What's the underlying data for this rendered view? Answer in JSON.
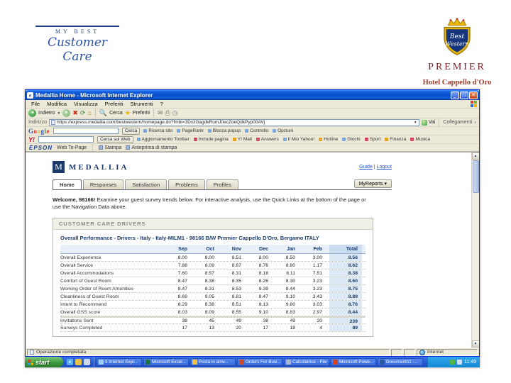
{
  "colors": {
    "medallia_navy": "#1b3a6b",
    "xp_titlebar_blue": "#0a50cf",
    "taskbar_blue": "#2458d4",
    "start_green": "#3c9a3c",
    "best_western_gold": "#e8b50c",
    "premier_maroon": "#7b1e24",
    "total_column_blue": "#dce9f5"
  },
  "slide": {
    "logo_left": {
      "line1": "MY BEST",
      "line2": "Customer Care"
    },
    "logo_right": {
      "shield_line1": "Best",
      "shield_line2": "Western",
      "premier": "PREMIER",
      "hotel": "Hotel Cappello d'Oro"
    }
  },
  "browser": {
    "title": "Medallia Home - Microsoft Internet Explorer",
    "menu": [
      "File",
      "Modifica",
      "Visualizza",
      "Preferiti",
      "Strumenti",
      "?"
    ],
    "toolbar": {
      "back": "Indietro",
      "search": "Cerca",
      "favorites": "Preferiti"
    },
    "address": {
      "label": "Indirizzo",
      "url": "https://express.medallia.com/bestwestern/homepage.do?fmbi=3DxzGagdkRumJ0ecZoeQdkPyp00AVj",
      "go": "Vai",
      "links": "Collegamenti"
    },
    "google": {
      "logo": "Google",
      "search_button": "Cerca",
      "items": [
        "Ricerca sito",
        "PageRank",
        "Blocca popup",
        "Controllo",
        "Opzioni"
      ]
    },
    "yahoo": {
      "logo": "Y!",
      "search_button": "Cerca sul Web",
      "items": [
        "Aggiornamento Toolbar",
        "Include pagina",
        "Y! Mail",
        "Answers",
        "Il Mio Yahoo!",
        "Hotline",
        "Giochi",
        "Sport",
        "Finanza",
        "Musica"
      ]
    },
    "epson": {
      "brand": "EPSON",
      "label": "Web To-Page",
      "print": "Stampa",
      "preview": "Anteprima di stampa"
    },
    "status": {
      "left": "Operazione completata",
      "zone": "Internet"
    }
  },
  "page": {
    "brand": "MEDALLIA",
    "brand_initial": "M",
    "links": {
      "guide": "Guide",
      "sep": "|",
      "logout": "Logout"
    },
    "tabs": [
      "Home",
      "Responses",
      "Satisfaction",
      "Problems",
      "Profiles"
    ],
    "active_tab": 0,
    "myreports": "MyReports ▾",
    "welcome_bold": "Welcome, 98166!",
    "welcome_text": "Examine your guest survey trends below. For interactive analysis, use the Quick Links at the bottom of the page or use the Navigation Data above.",
    "section_title": "CUSTOMER CARE DRIVERS",
    "table": {
      "title": "Overall Performance - Drivers - Italy - Italy-MILM1 - 98166 B/W Premier Cappello D'Oro, Bergamo ITALY",
      "columns": [
        "Sep",
        "Oct",
        "Nov",
        "Dec",
        "Jan",
        "Feb"
      ],
      "total_column": "Total",
      "rows": [
        {
          "label": "Overall Experience",
          "values": [
            "8.00",
            "8.00",
            "8.51",
            "8.00",
            "8.50",
            "3.00"
          ],
          "total": "8.56"
        },
        {
          "label": "Overall Service",
          "values": [
            "7.88",
            "8.09",
            "8.67",
            "8.76",
            "8.80",
            "1.17"
          ],
          "total": "8.62"
        },
        {
          "label": "Overall Accommodations",
          "values": [
            "7.60",
            "8.57",
            "8.31",
            "8.18",
            "8.11",
            "7.51"
          ],
          "total": "8.38"
        },
        {
          "label": "Comfort of Guest Room",
          "values": [
            "8.47",
            "8.38",
            "8.35",
            "8.26",
            "8.30",
            "3.23"
          ],
          "total": "8.60"
        },
        {
          "label": "Working Order of Room Amenities",
          "values": [
            "8.47",
            "8.31",
            "8.53",
            "9.39",
            "8.44",
            "3.23"
          ],
          "total": "8.75"
        },
        {
          "label": "Cleanliness of Guest Room",
          "values": [
            "8.69",
            "9.05",
            "8.81",
            "8.47",
            "9.10",
            "3.43"
          ],
          "total": "8.89"
        },
        {
          "label": "Intent to Recommend",
          "values": [
            "8.29",
            "8.38",
            "8.51",
            "8.13",
            "9.80",
            "3.03"
          ],
          "total": "8.76"
        },
        {
          "label": "Overall GSS score",
          "values": [
            "8.03",
            "8.09",
            "8.55",
            "9.10",
            "8.83",
            "2.97"
          ],
          "total": "8.44"
        }
      ],
      "count_rows": [
        {
          "label": "Invitations Sent",
          "values": [
            "38",
            "45",
            "49",
            "38",
            "49",
            "20"
          ],
          "total": "239"
        },
        {
          "label": "Surveys Completed",
          "values": [
            "17",
            "13",
            "20",
            "17",
            "18",
            "4"
          ],
          "total": "89"
        }
      ]
    }
  },
  "taskbar": {
    "start": "start",
    "tasks": [
      {
        "kind": "ie",
        "label": "5 Internet Expl..."
      },
      {
        "kind": "excel",
        "label": "Microsoft Excel..."
      },
      {
        "kind": "mail",
        "label": "Posta in arriv..."
      },
      {
        "kind": "doc",
        "label": "Orders For Busi..."
      },
      {
        "kind": "calc",
        "label": "Calcolatrice - File"
      },
      {
        "kind": "ppt",
        "label": "Microsoft Powe..."
      },
      {
        "kind": "word",
        "label": "Documento1 -..."
      }
    ],
    "time": "11:49"
  }
}
